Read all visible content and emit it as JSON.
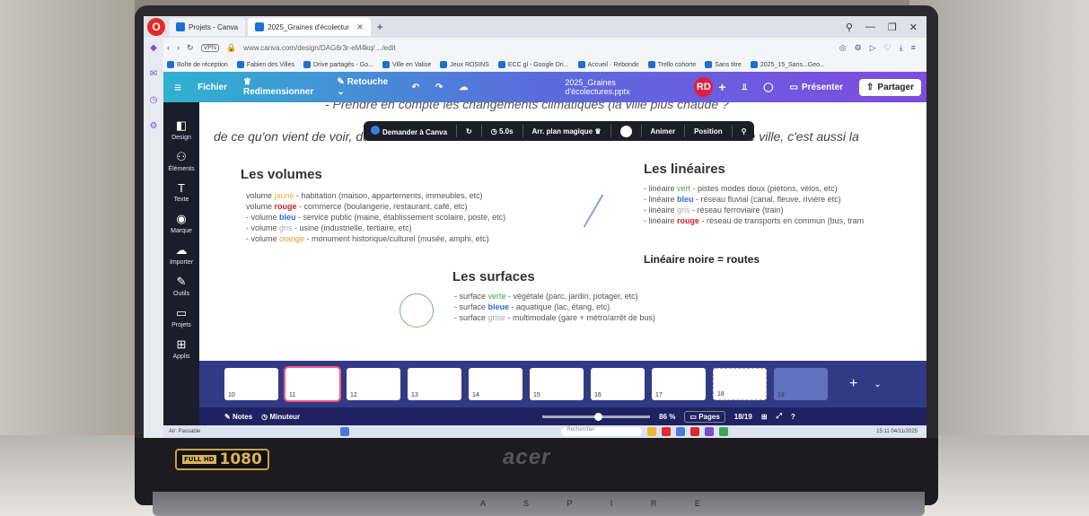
{
  "browser": {
    "tabs": [
      {
        "label": "Projets - Canva",
        "active": false
      },
      {
        "label": "2025_Graines d'écolectur",
        "active": true
      }
    ],
    "new_tab": "+",
    "url": "www.canva.com/design/DAG6r3r-eM4kq/…/edit",
    "bookmarks": [
      "Boîte de réception",
      "Fabien des Villes",
      "Drive partagés - Go...",
      "Ville en Valise",
      "Jeux ROSINS",
      "ECC gl - Google Dri...",
      "Accueil · Rebondir",
      "Trello cohorte",
      "Sans titre",
      "2025_15_Sans...Geo..."
    ]
  },
  "canva": {
    "menu": {
      "file": "Fichier",
      "resize": "Redimensionner",
      "retouch": "Retouche"
    },
    "file_name": "2025_Graines d'écolectures.pptx",
    "avatar": "RD",
    "present": "Présenter",
    "share": "Partager",
    "rail": [
      {
        "label": "Design",
        "icon": "design-icon"
      },
      {
        "label": "Éléments",
        "icon": "elements-icon"
      },
      {
        "label": "Texte",
        "icon": "text-icon"
      },
      {
        "label": "Marque",
        "icon": "brand-icon"
      },
      {
        "label": "Importer",
        "icon": "upload-icon"
      },
      {
        "label": "Outils",
        "icon": "tools-icon"
      },
      {
        "label": "Projets",
        "icon": "projects-icon"
      },
      {
        "label": "Applis",
        "icon": "apps-icon"
      }
    ],
    "floatbar": {
      "ask": "Demander à Canva",
      "duration": "5.0s",
      "bg_remove": "Arr. plan magique",
      "animate": "Animer",
      "position": "Position"
    },
    "slide": {
      "line1": "- Prendre en compte les changements climatiques (la ville plus chaude ?",
      "line2": "de ce qu'on vient de voir, du livre \"Abécédaire de la désobéissance civile\" et de votre vécu ! Cette ville, c'est aussi la",
      "volumes_title": "Les volumes",
      "volumes": [
        {
          "pre": "volume ",
          "word": "jaune",
          "post": " - habitation (maison, appartements, immeubles, etc)"
        },
        {
          "pre": "volume ",
          "word": "rouge",
          "post": " - commerce (boulangerie, restaurant, café, etc)"
        },
        {
          "pre": "- volume ",
          "word": "bleu",
          "post": " - service public (mairie, établissement scolaire, poste, etc)"
        },
        {
          "pre": "- volume ",
          "word": "gris",
          "post": " - usine (industrielle, tertiaire, etc)"
        },
        {
          "pre": "- volume ",
          "word": "orange",
          "post": " - monument historique/culturel (musée, amphi, etc)"
        }
      ],
      "lineaires_title": "Les linéaires",
      "lineaires": [
        {
          "pre": "- linéaire ",
          "word": "vert",
          "post": " - pistes modes doux (piétons, vélos, etc)"
        },
        {
          "pre": "- linéaire ",
          "word": "bleu",
          "post": " - réseau fluvial (canal, fleuve, rivière etc)"
        },
        {
          "pre": "- linéaire ",
          "word": "gris",
          "post": " - réseau ferroviaire (train)"
        },
        {
          "pre": "- linéaire ",
          "word": "rouge",
          "post": " - réseau de transports en commun (bus, tram"
        }
      ],
      "lineaire_noire": "Linéaire noire = routes",
      "surfaces_title": "Les surfaces",
      "surfaces": [
        {
          "pre": "- surface ",
          "word": "verte",
          "post": " - végétale (parc, jardin, potager, etc)"
        },
        {
          "pre": "- surface ",
          "word": "bleue",
          "post": " - aquatique (lac, étang, etc)"
        },
        {
          "pre": "- surface ",
          "word": "grise",
          "post": " - multimodale (gare + métro/arrêt de bus)"
        }
      ]
    },
    "thumbnails": [
      "10",
      "11",
      "12",
      "13",
      "14",
      "15",
      "16",
      "17",
      "18",
      "19"
    ],
    "bottom": {
      "notes": "Notes",
      "timer": "Minuteur",
      "zoom": "86 %",
      "pages": "Pages",
      "page_count": "18/19"
    },
    "taskbar": {
      "search": "Rechercher",
      "weather": "Air: Passable",
      "time": "15:11",
      "date": "04/11/2025"
    }
  },
  "laptop": {
    "hd_badge": "1080",
    "brand": "acer",
    "model": "A S P I R E"
  },
  "colors": {
    "canva_gradient_start": "#2fb2d0",
    "canva_gradient_end": "#7f4be0",
    "rail": "#1b1d2a",
    "filmstrip": "#323a86",
    "avatar": "#e21d41"
  }
}
